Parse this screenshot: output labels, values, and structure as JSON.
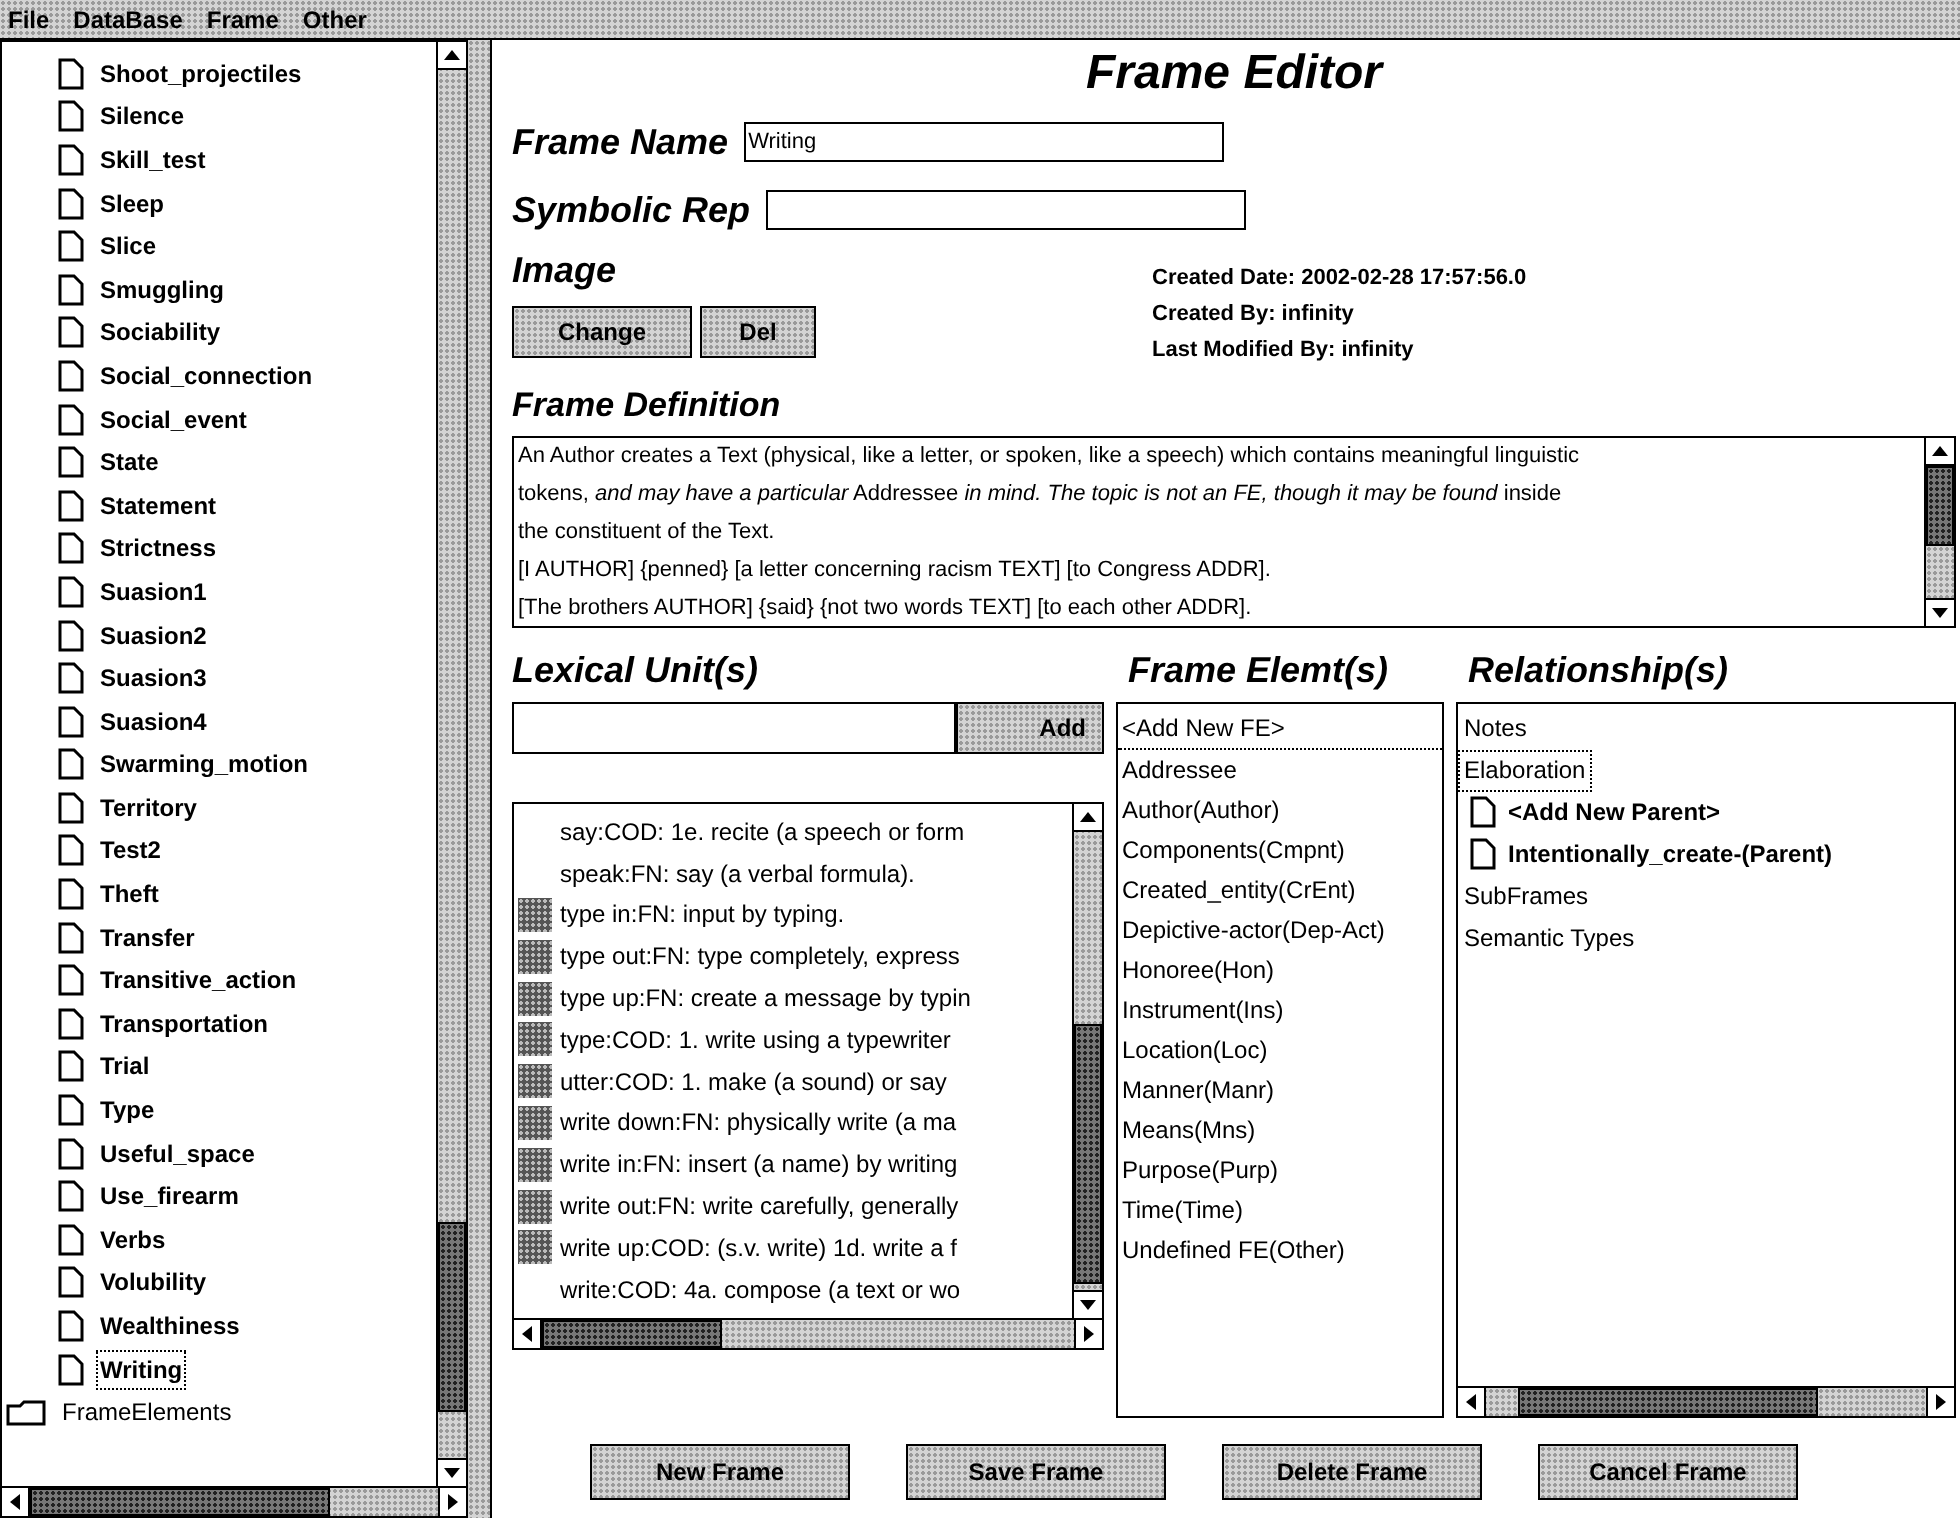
{
  "menu": [
    "File",
    "DataBase",
    "Frame",
    "Other"
  ],
  "tree": {
    "items": [
      {
        "label": "Shoot_projectiles",
        "kind": "frame",
        "selected": false
      },
      {
        "label": "Silence",
        "kind": "frame",
        "selected": false
      },
      {
        "label": "Skill_test",
        "kind": "frame",
        "selected": false
      },
      {
        "label": "Sleep",
        "kind": "frame",
        "selected": false
      },
      {
        "label": "Slice",
        "kind": "frame",
        "selected": false
      },
      {
        "label": "Smuggling",
        "kind": "frame",
        "selected": false
      },
      {
        "label": "Sociability",
        "kind": "frame",
        "selected": false
      },
      {
        "label": "Social_connection",
        "kind": "frame",
        "selected": false
      },
      {
        "label": "Social_event",
        "kind": "frame",
        "selected": false
      },
      {
        "label": "State",
        "kind": "frame",
        "selected": false
      },
      {
        "label": "Statement",
        "kind": "frame",
        "selected": false
      },
      {
        "label": "Strictness",
        "kind": "frame",
        "selected": false
      },
      {
        "label": "Suasion1",
        "kind": "frame",
        "selected": false
      },
      {
        "label": "Suasion2",
        "kind": "frame",
        "selected": false
      },
      {
        "label": "Suasion3",
        "kind": "frame",
        "selected": false
      },
      {
        "label": "Suasion4",
        "kind": "frame",
        "selected": false
      },
      {
        "label": "Swarming_motion",
        "kind": "frame",
        "selected": false
      },
      {
        "label": "Territory",
        "kind": "frame",
        "selected": false
      },
      {
        "label": "Test2",
        "kind": "frame",
        "selected": false
      },
      {
        "label": "Theft",
        "kind": "frame",
        "selected": false
      },
      {
        "label": "Transfer",
        "kind": "frame",
        "selected": false
      },
      {
        "label": "Transitive_action",
        "kind": "frame",
        "selected": false
      },
      {
        "label": "Transportation",
        "kind": "frame",
        "selected": false
      },
      {
        "label": "Trial",
        "kind": "frame",
        "selected": false
      },
      {
        "label": "Type",
        "kind": "frame",
        "selected": false
      },
      {
        "label": "Useful_space",
        "kind": "frame",
        "selected": false
      },
      {
        "label": "Use_firearm",
        "kind": "frame",
        "selected": false
      },
      {
        "label": "Verbs",
        "kind": "frame",
        "selected": false
      },
      {
        "label": "Volubility",
        "kind": "frame",
        "selected": false
      },
      {
        "label": "Wealthiness",
        "kind": "frame",
        "selected": false
      },
      {
        "label": "Writing",
        "kind": "frame",
        "selected": true
      },
      {
        "label": "FrameElements",
        "kind": "folder",
        "selected": false
      }
    ]
  },
  "editor": {
    "title": "Frame Editor",
    "frame_name": {
      "label": "Frame Name",
      "value": "Writing"
    },
    "symbolic_rep": {
      "label": "Symbolic Rep"
    },
    "image": {
      "label": "Image",
      "buttons": [
        "Change",
        "Del"
      ]
    },
    "info": [
      "Created Date: 2002-02-28 17:57:56.0",
      "Created By: infinity",
      "Last Modified By: infinity"
    ],
    "definition": {
      "heading": "Frame Definition",
      "lines": [
        "An Author creates a Text (physical, like a letter, or spoken, like a speech) which contains meaningful linguistic",
        "tokens, *and may have a particular* Addressee *in mind.  The topic is not an FE, though it may be found* inside",
        "the constituent of the Text.",
        "[I AUTHOR] {penned} [a letter concerning racism TEXT] [to Congress ADDR].",
        "[The brothers AUTHOR] {said} {not two words TEXT] [to each other ADDR]."
      ]
    },
    "lexical_units": {
      "heading": "Lexical Unit(s)",
      "add_button": "Add",
      "items": [
        {
          "text": "say:COD:  1e. recite (a speech or form",
          "annotated": false
        },
        {
          "text": "speak:FN: say (a verbal formula).",
          "annotated": false
        },
        {
          "text": "type in:FN: input by typing.",
          "annotated": true
        },
        {
          "text": "type out:FN: type completely, express",
          "annotated": true
        },
        {
          "text": "type up:FN: create a message by typin",
          "annotated": true
        },
        {
          "text": "type:COD: 1. write using a typewriter",
          "annotated": true
        },
        {
          "text": "utter:COD:  1.  make (a sound) or say",
          "annotated": true
        },
        {
          "text": "write down:FN: physically write (a ma",
          "annotated": true
        },
        {
          "text": "write in:FN:  insert (a name) by writing",
          "annotated": true
        },
        {
          "text": "write out:FN: write carefully, generally",
          "annotated": true
        },
        {
          "text": "write up:COD: (s.v. write) 1d. write a f",
          "annotated": true
        },
        {
          "text": "write:COD: 4a. compose (a text or wo",
          "annotated": false
        }
      ]
    },
    "frame_elements": {
      "heading": "Frame Elemt(s)",
      "items": [
        {
          "label": "<Add New FE>",
          "selected": true
        },
        {
          "label": "Addressee",
          "selected": false
        },
        {
          "label": "Author(Author)",
          "selected": false
        },
        {
          "label": "Components(Cmpnt)",
          "selected": false
        },
        {
          "label": "Created_entity(CrEnt)",
          "selected": false
        },
        {
          "label": "Depictive-actor(Dep-Act)",
          "selected": false
        },
        {
          "label": "Honoree(Hon)",
          "selected": false
        },
        {
          "label": "Instrument(Ins)",
          "selected": false
        },
        {
          "label": "Location(Loc)",
          "selected": false
        },
        {
          "label": "Manner(Manr)",
          "selected": false
        },
        {
          "label": "Means(Mns)",
          "selected": false
        },
        {
          "label": "Purpose(Purp)",
          "selected": false
        },
        {
          "label": "Time(Time)",
          "selected": false
        },
        {
          "label": "Undefined FE(Other)",
          "selected": false
        }
      ]
    },
    "relationships": {
      "heading": "Relationship(s)",
      "items": [
        {
          "label": "Notes",
          "selected": false
        },
        {
          "label": "Elaboration",
          "selected": true,
          "children": [
            {
              "label": "<Add New Parent>",
              "selected": false
            },
            {
              "label": "Intentionally_create-(Parent)",
              "selected": false
            }
          ]
        },
        {
          "label": "SubFrames",
          "selected": false
        },
        {
          "label": "Semantic Types",
          "selected": false
        }
      ]
    },
    "buttons": [
      "New Frame",
      "Save Frame",
      "Delete Frame",
      "Cancel Frame"
    ]
  }
}
